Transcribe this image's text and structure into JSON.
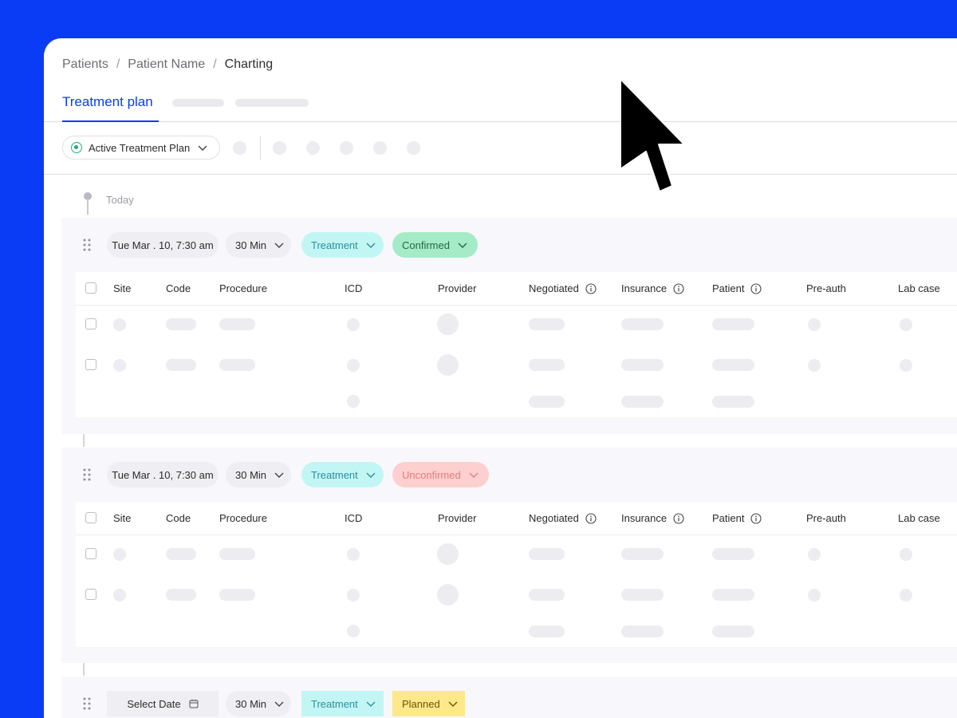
{
  "breadcrumb": {
    "items": [
      "Patients",
      "Patient Name",
      "Charting"
    ],
    "separator": "/"
  },
  "tabs": {
    "active_label": "Treatment plan"
  },
  "toolbar": {
    "plan_select_label": "Active Treatment Plan"
  },
  "timeline": {
    "today_label": "Today"
  },
  "table_columns": {
    "site": "Site",
    "code": "Code",
    "procedure": "Procedure",
    "icd": "ICD",
    "provider": "Provider",
    "negotiated": "Negotiated",
    "insurance": "Insurance",
    "patient": "Patient",
    "preauth": "Pre-auth",
    "labcase": "Lab case"
  },
  "appointments": [
    {
      "date": "Tue Mar . 10, 7:30 am",
      "duration": "30 Min",
      "type": "Treatment",
      "status": "Confirmed",
      "status_color": "#a6ebc8"
    },
    {
      "date": "Tue Mar . 10, 7:30 am",
      "duration": "30 Min",
      "type": "Treatment",
      "status": "Unconfirmed",
      "status_color": "#fdcfcf"
    },
    {
      "date": "Select Date",
      "duration": "30 Min",
      "type": "Treatment",
      "status": "Planned",
      "status_color": "#fde98a"
    }
  ],
  "icons": {
    "radio": "radio-selected-icon",
    "chevron": "chevron-down-icon",
    "drag": "drag-handle-icon",
    "info": "info-icon",
    "calendar": "calendar-icon",
    "cursor": "mouse-pointer-icon"
  },
  "colors": {
    "accent": "#0a3cf5",
    "background": "#0a3cf5",
    "radio": "#1db07e"
  }
}
